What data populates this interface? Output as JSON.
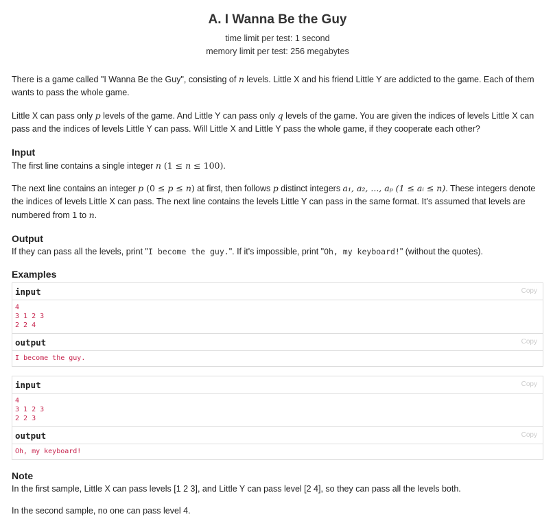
{
  "problem": {
    "title": "A. I Wanna Be the Guy",
    "time_limit": "time limit per test: 1 second",
    "memory_limit": "memory limit per test: 256 megabytes"
  },
  "statement": {
    "p1_a": "There is a game called \"I Wanna Be the Guy\", consisting of ",
    "p1_n": "n",
    "p1_b": " levels. Little X and his friend Little Y are addicted to the game. Each of them wants to pass the whole game.",
    "p2_a": "Little X can pass only ",
    "p2_p": "p",
    "p2_b": " levels of the game. And Little Y can pass only ",
    "p2_q": "q",
    "p2_c": " levels of the game. You are given the indices of levels Little X can pass and the indices of levels Little Y can pass. Will Little X and Little Y pass the whole game, if they cooperate each other?"
  },
  "input_section": {
    "title": "Input",
    "l1_a": "The first line contains a single integer ",
    "l1_math": "n",
    "l1_range": " (1 ≤ ",
    "l1_n": "n",
    "l1_range2": " ≤ 100)",
    "l1_b": ".",
    "l2_a": "The next line contains an integer ",
    "l2_p": "p",
    "l2_range_a": " (0 ≤ ",
    "l2_p2": "p",
    "l2_range_b": " ≤ ",
    "l2_n": "n",
    "l2_range_c": ")",
    "l2_b": " at first, then follows ",
    "l2_p3": "p",
    "l2_c": " distinct integers ",
    "l2_seq": "a",
    "l2_d": "₁, a₂, ..., aₚ",
    "l2_range2": " (1 ≤ aᵢ ≤ n)",
    "l2_e": ". These integers denote the indices of levels Little X can pass. The next line contains the levels Little Y can pass in the same format. It's assumed that levels are numbered from 1 to ",
    "l2_end_n": "n",
    "l2_f": "."
  },
  "output_section": {
    "title": "Output",
    "a": "If they can pass all the levels, print \"",
    "ok": "I become the guy.",
    "b": "\". If it's impossible, print \"",
    "bad": "Oh, my keyboard!",
    "c": "\" (without the quotes)."
  },
  "examples": {
    "title": "Examples",
    "input_label": "input",
    "output_label": "output",
    "copy_label": "Copy",
    "items": [
      {
        "input": "4\n3 1 2 3\n2 2 4",
        "output": "I become the guy."
      },
      {
        "input": "4\n3 1 2 3\n2 2 3",
        "output": "Oh, my keyboard!"
      }
    ]
  },
  "note": {
    "title": "Note",
    "p1": "In the first sample, Little X can pass levels [1 2 3], and Little Y can pass level [2 4], so they can pass all the levels both.",
    "p2": "In the second sample, no one can pass level 4."
  }
}
